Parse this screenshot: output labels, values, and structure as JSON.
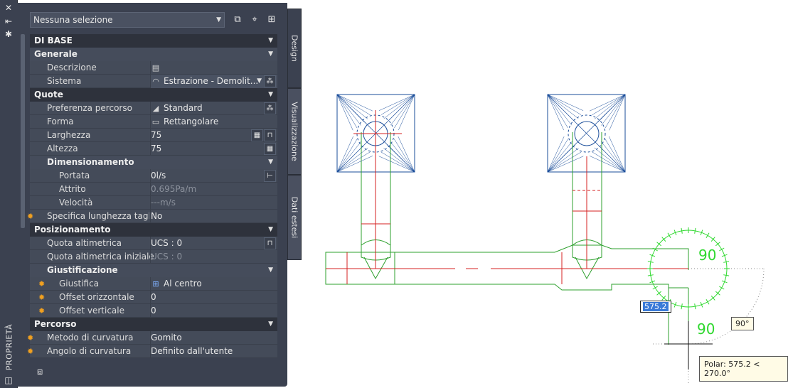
{
  "strip": {
    "title": "PROPRIETÀ",
    "icons": [
      "close-icon",
      "pin-icon",
      "settings-icon",
      "palette-icon"
    ]
  },
  "selector": {
    "value": "Nessuna selezione",
    "icons": [
      "quick-select-icon",
      "pick-object-icon",
      "toggle-pickadd-icon"
    ]
  },
  "tabs": [
    "Design",
    "Visualizzazione",
    "Dati estesi"
  ],
  "categories": {
    "basic": "DI BASE",
    "general": "Generale",
    "quote": "Quote",
    "dimensioning": "Dimensionamento",
    "positioning": "Posizionamento",
    "justification": "Giustificazione",
    "path": "Percorso"
  },
  "props": {
    "descrizione": {
      "label": "Descrizione",
      "value": ""
    },
    "sistema": {
      "label": "Sistema",
      "value": "Estrazione - Demolit..."
    },
    "preferenza": {
      "label": "Preferenza percorso",
      "value": "Standard"
    },
    "forma": {
      "label": "Forma",
      "value": "Rettangolare"
    },
    "larghezza": {
      "label": "Larghezza",
      "value": "75"
    },
    "altezza": {
      "label": "Altezza",
      "value": "75"
    },
    "portata": {
      "label": "Portata",
      "value": "0l/s"
    },
    "attrito": {
      "label": "Attrito",
      "value": "0.695Pa/m"
    },
    "velocita": {
      "label": "Velocità",
      "value": "---m/s"
    },
    "specifica": {
      "label": "Specifica lunghezza tagl...",
      "value": "No"
    },
    "quota_alt": {
      "label": "Quota altimetrica",
      "value": "UCS : 0"
    },
    "quota_alt_iniz": {
      "label": "Quota altimetrica iniziale",
      "value": "UCS : 0"
    },
    "giustifica": {
      "label": "Giustifica",
      "value": "Al centro"
    },
    "offset_orizz": {
      "label": "Offset orizzontale",
      "value": "0"
    },
    "offset_vert": {
      "label": "Offset verticale",
      "value": "0"
    },
    "metodo": {
      "label": "Metodo di curvatura",
      "value": "Gomito"
    },
    "angolo": {
      "label": "Angolo di curvatura",
      "value": "Definito dall'utente"
    }
  },
  "drawing": {
    "dim_input": "575.2",
    "angle_tip": "90°",
    "polar_tip": "Polar: 575.2 < 270.0°",
    "angle_label_top": "90",
    "angle_label_bottom": "90",
    "colors": {
      "duct": "#2ea02e",
      "center": "#d42020",
      "diffuser": "#1a4d9a",
      "guide": "#888888"
    }
  }
}
